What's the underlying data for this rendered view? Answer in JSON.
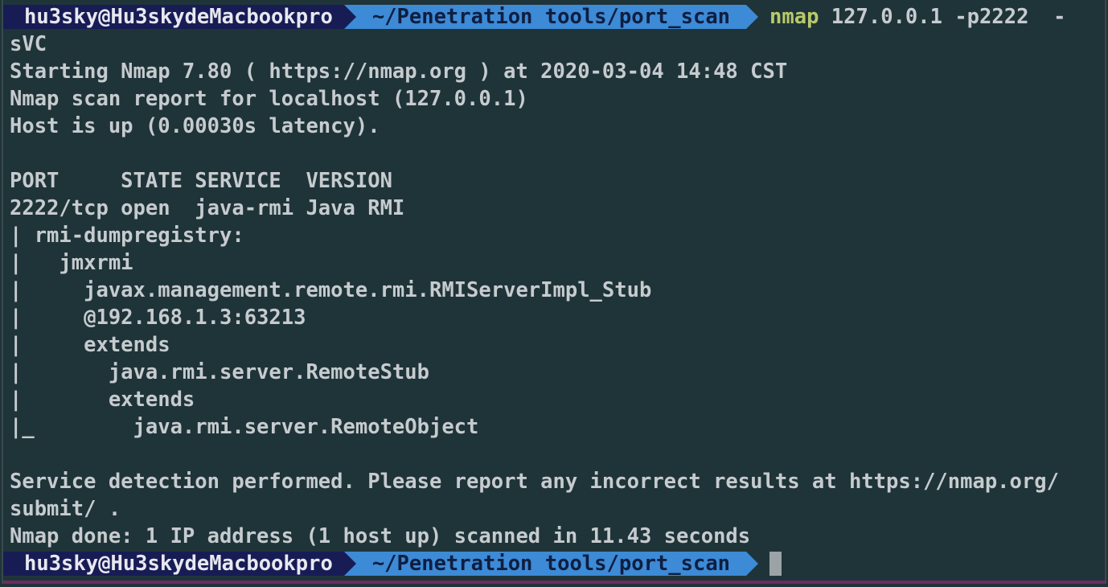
{
  "prompt": {
    "user_host": "hu3sky@Hu3skydeMacbookpro",
    "path": "~/Penetration tools/port_scan"
  },
  "command": {
    "name": "nmap",
    "args": " 127.0.0.1 -p2222  -"
  },
  "output_lines": [
    "sVC",
    "Starting Nmap 7.80 ( https://nmap.org ) at 2020-03-04 14:48 CST",
    "Nmap scan report for localhost (127.0.0.1)",
    "Host is up (0.00030s latency).",
    "",
    "PORT     STATE SERVICE  VERSION",
    "2222/tcp open  java-rmi Java RMI",
    "| rmi-dumpregistry:",
    "|   jmxrmi",
    "|     javax.management.remote.rmi.RMIServerImpl_Stub",
    "|     @192.168.1.3:63213",
    "|     extends",
    "|       java.rmi.server.RemoteStub",
    "|       extends",
    "|_        java.rmi.server.RemoteObject",
    "",
    "Service detection performed. Please report any incorrect results at https://nmap.org/",
    "submit/ .",
    "Nmap done: 1 IP address (1 host up) scanned in 11.43 seconds"
  ],
  "colors": {
    "background": "#1f3438",
    "user_segment": "#171c55",
    "path_segment": "#3d8ad6",
    "command_name": "#b9c96b",
    "text": "#c6cbcf"
  }
}
